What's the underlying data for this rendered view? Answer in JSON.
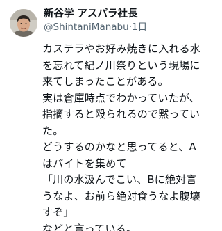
{
  "author": {
    "display_name": "新谷学 アスパラ社長",
    "handle": "@ShintaniManabu",
    "separator": "·",
    "time": "1日"
  },
  "tweet": {
    "lines": [
      "カステラやお好み焼きに入れる水",
      "を忘れて紀ノ川祭りという現場に",
      "来てしまったことがある。",
      "実は倉庫時点でわかっていたが、",
      "指摘すると殴られるので黙ってい",
      "た。",
      "どうするのかなと思ってると、A",
      "はバイトを集めて",
      "「川の水汲んでこい、Bに絶対言",
      "うなよ、お前ら絶対食うなよ腹壊",
      "すぞ」",
      "などと言っている。"
    ]
  },
  "colors": {
    "text": "#0f1419",
    "secondary": "#536471",
    "background": "#ffffff"
  }
}
